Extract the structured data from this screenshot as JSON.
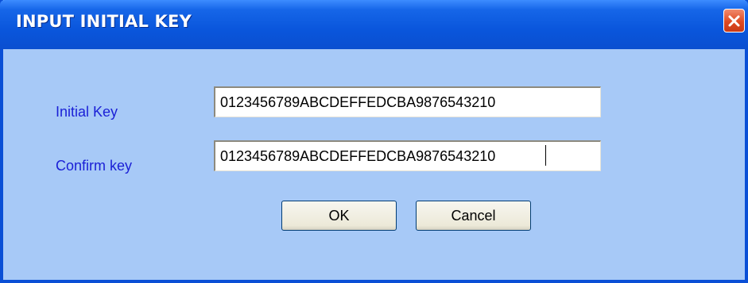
{
  "window": {
    "title": "INPUT INITIAL KEY",
    "close_icon": "close-icon",
    "colors": {
      "titlebar": "#0a56dc",
      "client_bg": "#a7c9f7",
      "label_text": "#1a1fd6",
      "close_button": "#df4a22"
    }
  },
  "form": {
    "initial_key_label": "Initial Key",
    "initial_key_value": "0123456789ABCDEFFEDCBA9876543210",
    "confirm_key_label": "Confirm key",
    "confirm_key_value": "0123456789ABCDEFFEDCBA9876543210"
  },
  "buttons": {
    "ok_label": "OK",
    "cancel_label": "Cancel"
  }
}
